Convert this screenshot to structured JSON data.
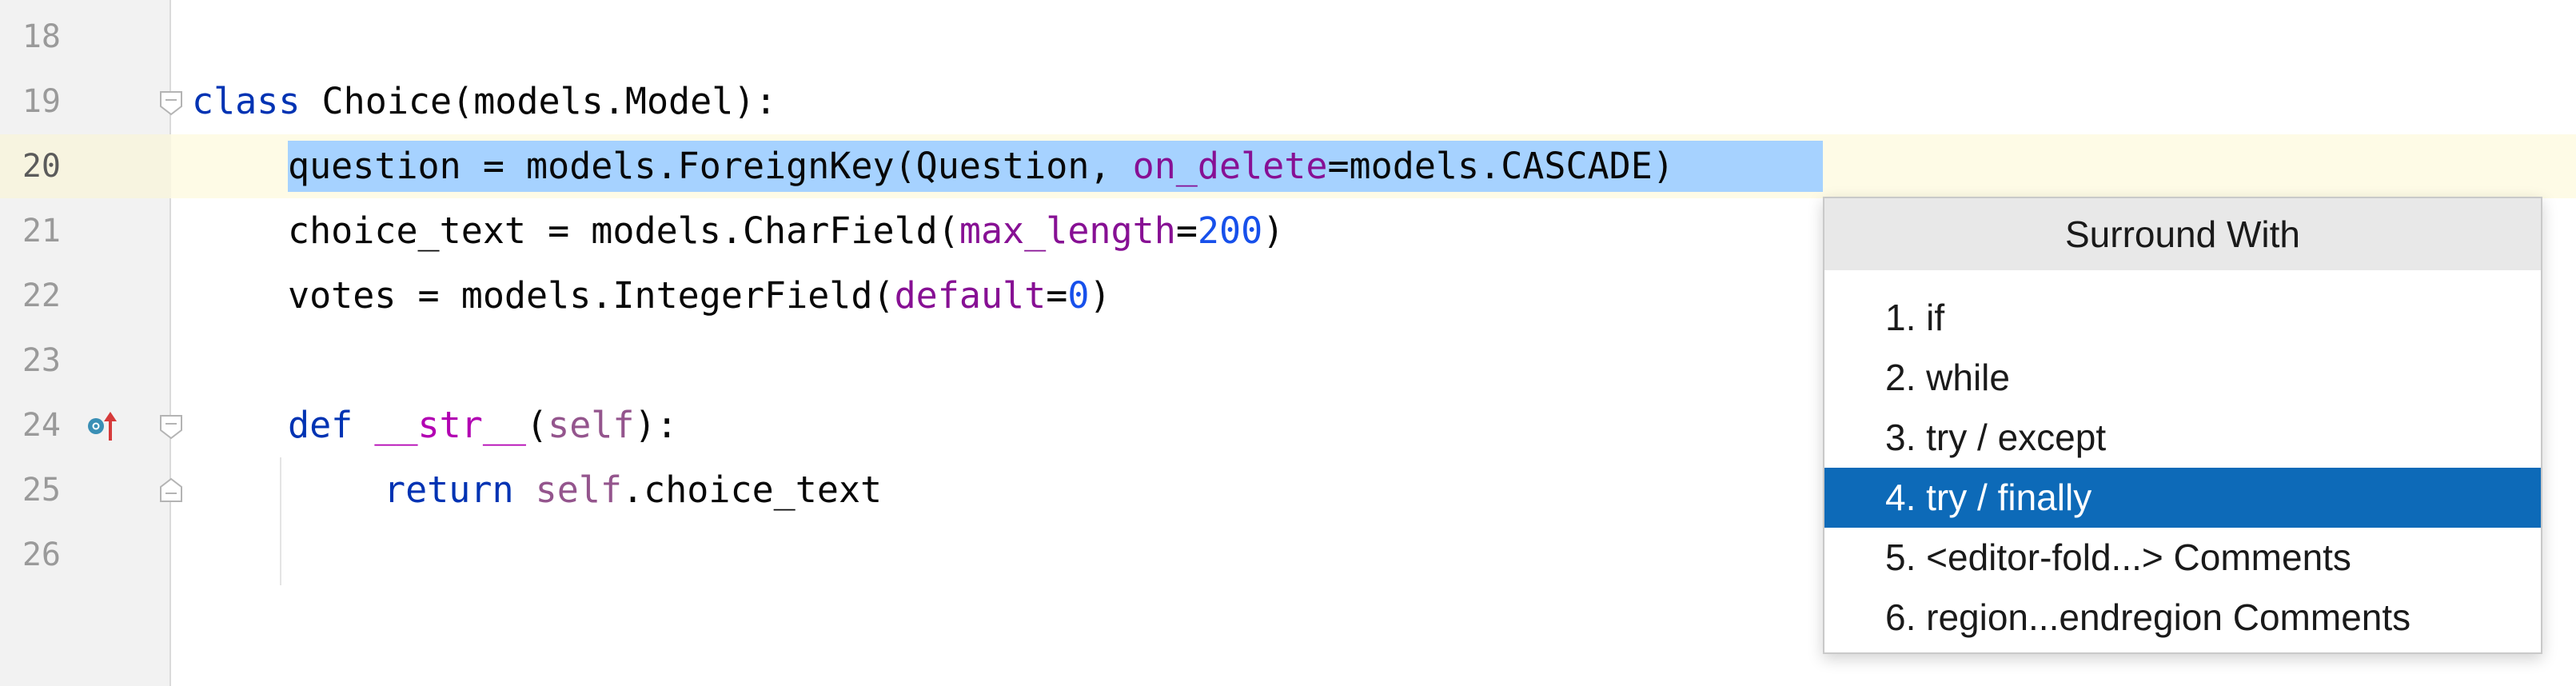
{
  "editor": {
    "line_numbers": [
      "18",
      "19",
      "20",
      "21",
      "22",
      "23",
      "24",
      "25",
      "26"
    ],
    "lines": {
      "l19": {
        "kw": "class",
        "rest": " Choice(models.Model):"
      },
      "l20": {
        "a": "question = models.ForeignKey(Question, ",
        "param": "on_delete",
        "b": "=models.CASCADE)"
      },
      "l21": {
        "a": "choice_text = models.CharField(",
        "param": "max_length",
        "eq": "=",
        "num": "200",
        "close": ")"
      },
      "l22": {
        "a": "votes = models.IntegerField(",
        "param": "default",
        "eq": "=",
        "num": "0",
        "close": ")"
      },
      "l24": {
        "kw": "def",
        "sp": " ",
        "name": "__str__",
        "open": "(",
        "self": "self",
        "close": "):"
      },
      "l25": {
        "kw": "return",
        "sp": " ",
        "self": "self",
        "rest": ".choice_text"
      }
    }
  },
  "icons": {
    "run_gutter": "implemented-method-icon",
    "fold": "fold-marker-icon"
  },
  "popup": {
    "title": "Surround With",
    "items": [
      "1. if",
      "2. while",
      "3. try / except",
      "4. try / finally",
      "5. <editor-fold...> Comments",
      "6. region...endregion Comments"
    ],
    "selected_index": 3
  },
  "colors": {
    "selection": "#a6d2ff",
    "popup_selected": "#0d6ab8",
    "keyword": "#0033b3",
    "parameter": "#871094",
    "number": "#1750eb"
  }
}
